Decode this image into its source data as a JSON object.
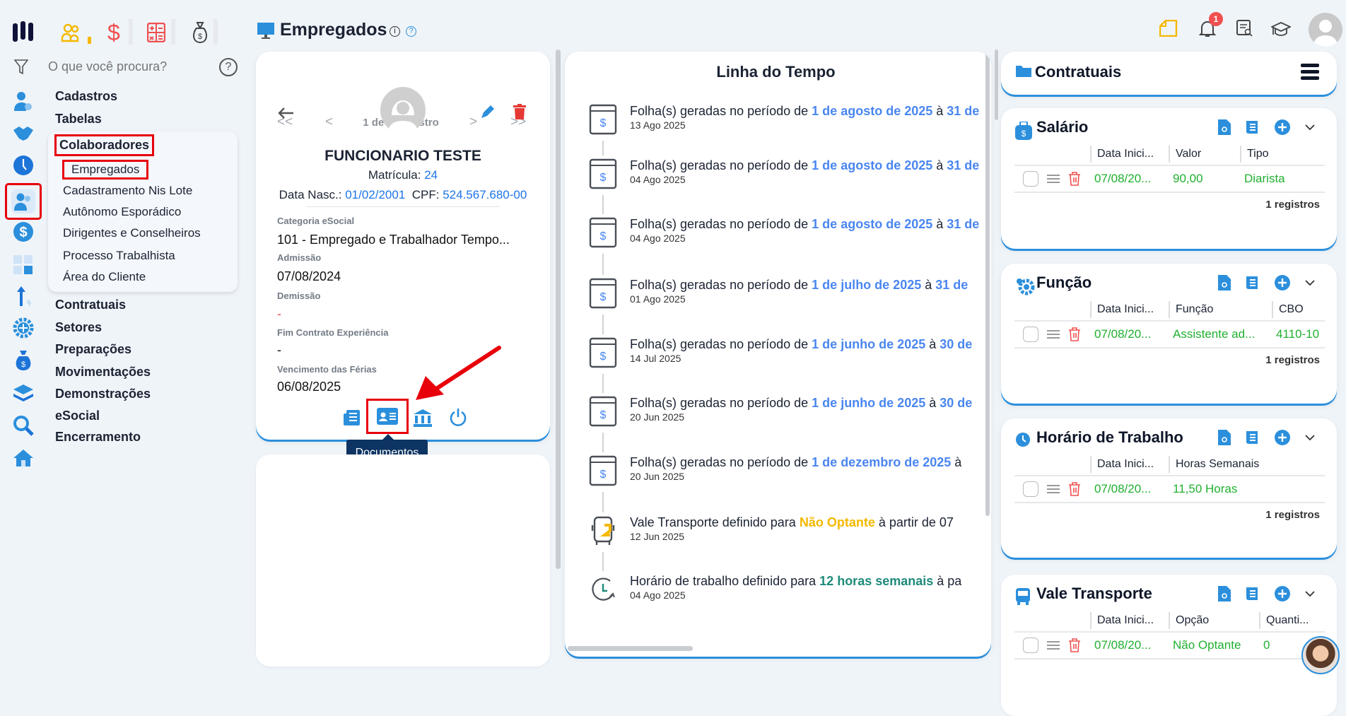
{
  "search": {
    "placeholder": "O que você procura?"
  },
  "page": {
    "title": "Empregados"
  },
  "menu": {
    "top": [
      "Cadastros",
      "Tabelas"
    ],
    "group": "Colaboradores",
    "sub": [
      "Empregados",
      "Cadastramento Nis Lote",
      "Autônomo Esporádico",
      "Dirigentes e Conselheiros",
      "Processo Trabalhista",
      "Área do Cliente"
    ],
    "bottom": [
      "Contratuais",
      "Setores",
      "Preparações",
      "Movimentações",
      "Demonstrações",
      "eSocial",
      "Encerramento"
    ]
  },
  "notifications": {
    "count": "1"
  },
  "employee": {
    "nav_label": "1 de 1 Registro",
    "first": "<<",
    "prev": "<",
    "next": ">",
    "last": ">>",
    "name": "FUNCIONARIO TESTE",
    "matricula_label": "Matrícula:",
    "matricula": "24",
    "nasc_label": "Data Nasc.:",
    "nasc": "01/02/2001",
    "cpf_label": "CPF:",
    "cpf": "524.567.680-00",
    "fields": [
      {
        "label": "Categoria eSocial",
        "value": "101 - Empregado e Trabalhador Tempo..."
      },
      {
        "label": "Admissão",
        "value": "07/08/2024"
      },
      {
        "label": "Demissão",
        "value": "-"
      },
      {
        "label": "Fim Contrato Experiência",
        "value": "-"
      },
      {
        "label": "Vencimento das Férias",
        "value": "06/08/2025"
      }
    ],
    "tooltip": "Documentos"
  },
  "timeline": {
    "title": "Linha do Tempo",
    "items": [
      {
        "icon": "payroll",
        "pre": "Folha(s) geradas no período de ",
        "hl": "1 de agosto de 2025",
        "mid": " à ",
        "hl2": "31 de",
        "date": "13 Ago 2025"
      },
      {
        "icon": "payroll",
        "pre": "Folha(s) geradas no período de ",
        "hl": "1 de agosto de 2025",
        "mid": " à ",
        "hl2": "31 de",
        "date": "04 Ago 2025"
      },
      {
        "icon": "payroll",
        "pre": "Folha(s) geradas no período de ",
        "hl": "1 de agosto de 2025",
        "mid": " à ",
        "hl2": "31 de",
        "date": "04 Ago 2025"
      },
      {
        "icon": "payroll",
        "pre": "Folha(s) geradas no período de ",
        "hl": "1 de julho de 2025",
        "mid": " à ",
        "hl2": "31 de",
        "date": "01 Ago 2025"
      },
      {
        "icon": "payroll",
        "pre": "Folha(s) geradas no período de ",
        "hl": "1 de junho de 2025",
        "mid": " à ",
        "hl2": "30 de",
        "date": "14 Jul 2025"
      },
      {
        "icon": "payroll",
        "pre": "Folha(s) geradas no período de ",
        "hl": "1 de junho de 2025",
        "mid": " à ",
        "hl2": "30 de",
        "date": "20 Jun 2025"
      },
      {
        "icon": "payroll",
        "pre": "Folha(s) geradas no período de ",
        "hl": "1 de dezembro de 2025",
        "mid": " à",
        "hl2": "",
        "date": "20 Jun 2025"
      },
      {
        "icon": "bus",
        "pre": "Vale Transporte definido para ",
        "hl": "Não Optante",
        "mid": " à partir de 07",
        "hl2": "",
        "date": "12 Jun 2025",
        "color": "#f5b800"
      },
      {
        "icon": "clock",
        "pre": "Horário de trabalho definido para ",
        "hl": "12 horas semanais",
        "mid": " à pa",
        "hl2": "",
        "date": "04 Ago 2025",
        "color": "#1e8a7a"
      }
    ]
  },
  "contratuais": {
    "title": "Contratuais"
  },
  "cards": [
    {
      "title": "Salário",
      "cols": [
        "Data Inici...",
        "Valor",
        "Tipo"
      ],
      "row": [
        "07/08/20...",
        "90,00",
        "Diarista"
      ],
      "count": "1 registros"
    },
    {
      "title": "Função",
      "cols": [
        "Data Inici...",
        "Função",
        "CBO"
      ],
      "row": [
        "07/08/20...",
        "Assistente ad...",
        "4110-10"
      ],
      "count": "1 registros"
    },
    {
      "title": "Horário de Trabalho",
      "cols": [
        "Data Inici...",
        "Horas Semanais"
      ],
      "row": [
        "07/08/20...",
        "11,50 Horas"
      ],
      "count": "1 registros"
    },
    {
      "title": "Vale Transporte",
      "cols": [
        "Data Inici...",
        "Opção",
        "Quanti..."
      ],
      "row": [
        "07/08/20...",
        "Não Optante",
        "0"
      ],
      "count": ""
    }
  ],
  "colors": {
    "accent": "#2b8fdc",
    "green": "#20b030",
    "red": "#e8000b",
    "tooltip": "#0d3462"
  }
}
